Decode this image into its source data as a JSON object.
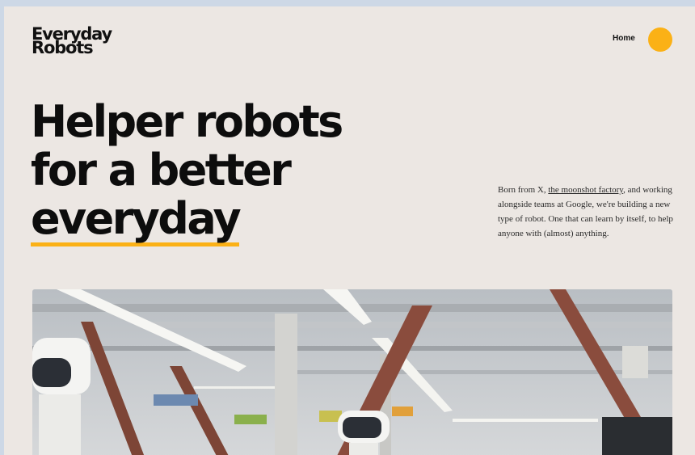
{
  "header": {
    "logo_line1": "Everyday",
    "logo_line2": "Robots",
    "nav_home": "Home"
  },
  "hero": {
    "headline_line1": "Helper robots",
    "headline_line2": "for a better",
    "headline_line3": "everyday",
    "desc_part1": "Born from X, ",
    "desc_link": "the moonshot factory",
    "desc_part2": ", and working alongside teams at Google, we're building a new type of robot. One that can learn by itself, to help anyone with (almost) anything."
  },
  "colors": {
    "page_bg": "#ece7e3",
    "accent": "#fbb116",
    "text": "#0d0d0d"
  },
  "image": {
    "subject": "robots-in-warehouse-photo"
  }
}
